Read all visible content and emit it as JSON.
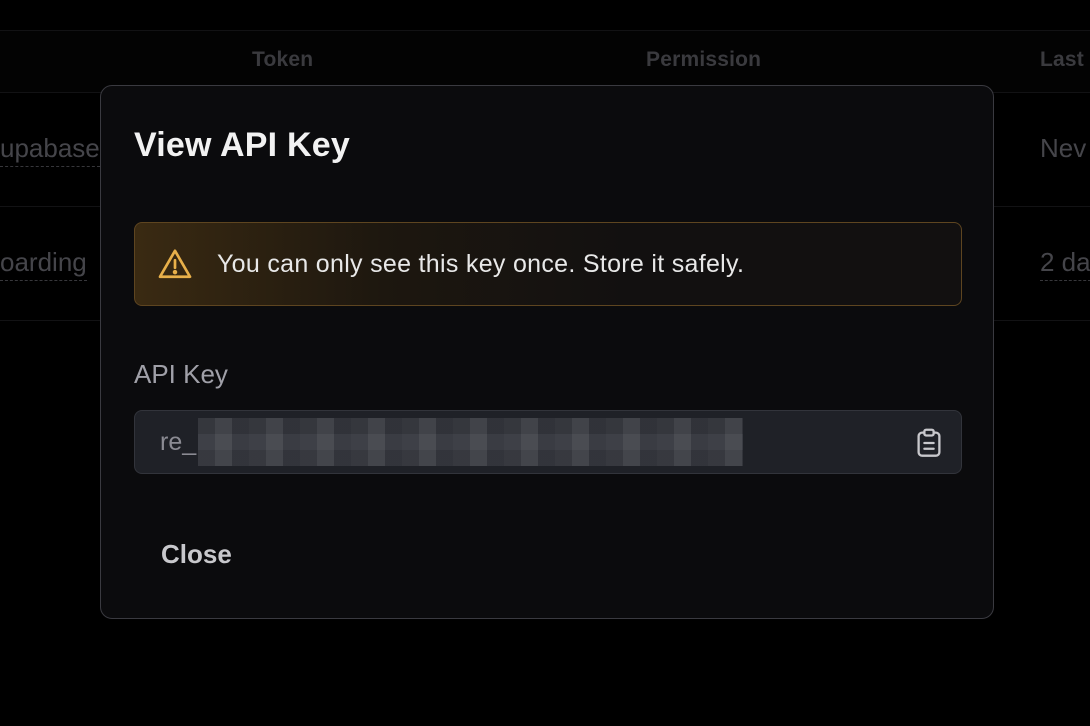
{
  "table": {
    "headers": [
      "Token",
      "Permission",
      "Last"
    ],
    "rows": [
      {
        "name": "upabase",
        "last_used": "Nev"
      },
      {
        "name": "oarding",
        "last_used": "2 da"
      }
    ]
  },
  "modal": {
    "title": "View API Key",
    "warning_icon": "warning-triangle-icon",
    "warning_text": "You can only see this key once. Store it safely.",
    "field_label": "API Key",
    "key_prefix": "re_",
    "copy_icon": "clipboard-icon",
    "close_label": "Close"
  },
  "colors": {
    "accent_warning": "#e8b04a",
    "background": "#000000",
    "modal_background": "#0b0b0d"
  }
}
